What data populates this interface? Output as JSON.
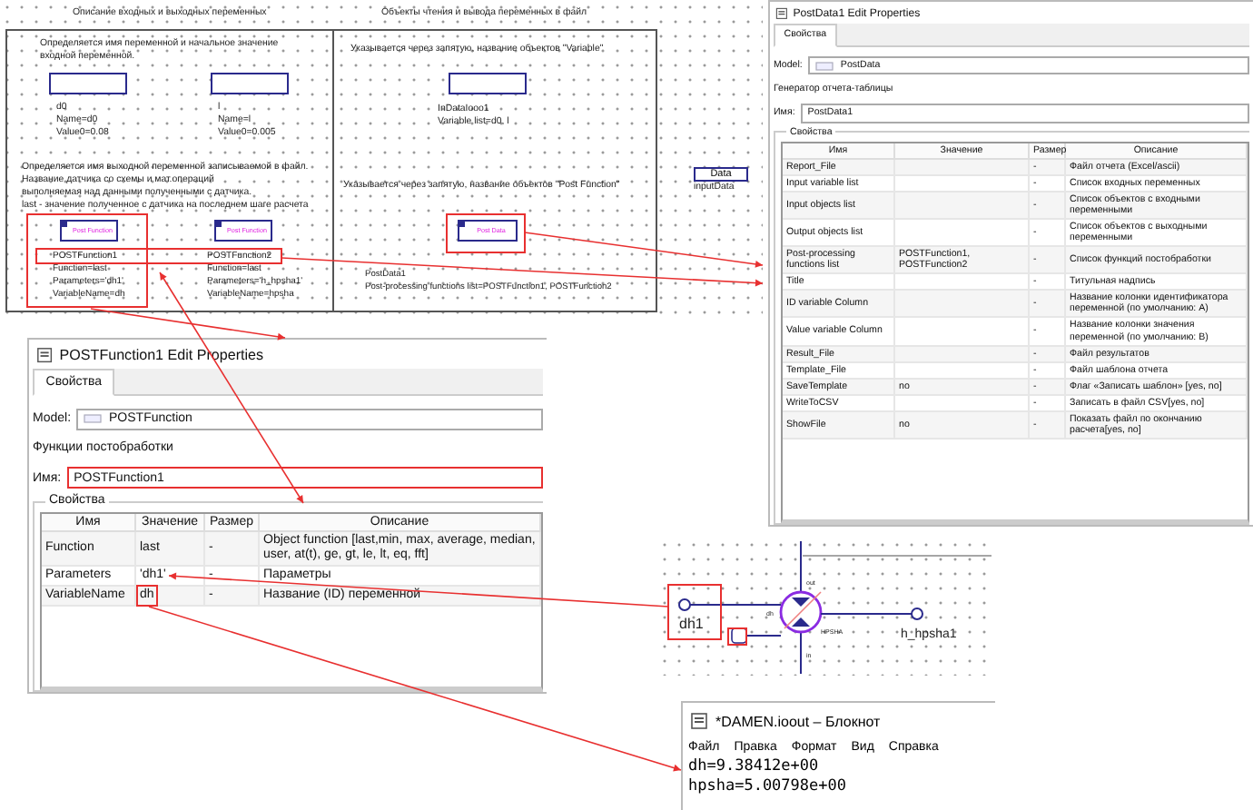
{
  "diagram": {
    "headers": [
      "Описание входных и выходных переменных",
      "Объекты чтения и вывода переменных в файл"
    ],
    "input_note": "Определяется имя переменной и начальное значение входной переменной.",
    "variables": [
      {
        "lines": [
          "d0",
          "Name=d0",
          "Value0=0.08"
        ]
      },
      {
        "lines": [
          "l",
          "Name=l",
          "Value0=0.005"
        ]
      }
    ],
    "output_note_lines": [
      "Определяется имя выходной переменной записываемой в файл.",
      "Название датчика со схемы и мат.операций",
      "выполняемая над данными полученными с датчика.",
      "last - значение полученное с датчика на последнем шаге расчета"
    ],
    "post_functions": [
      {
        "block": "Post Function",
        "lines": [
          "POSTFunction1",
          "Function=last",
          "Parameters='dh1'",
          "VariableName=dh"
        ]
      },
      {
        "block": "Post Function",
        "lines": [
          "POSTFunction2",
          "Function=last",
          "Parameters='h_hpsha1'",
          "VariableName=hpsha"
        ]
      }
    ],
    "variable_note": "Указывается через запятую, название объектов \"Variable\"",
    "input_object": {
      "lines": [
        "InDataIooo1",
        "Variable list=d0, l"
      ]
    },
    "function_note": "Указывается через запятую, название объектов \"Post Function\"",
    "post_data": {
      "block": "Post Data",
      "lines": [
        "PostData1",
        "Post-processing functions list=POSTFunction1, POSTFunction2"
      ]
    },
    "data_block": {
      "block": "Data",
      "caption": "inputData"
    }
  },
  "postdata_window": {
    "title": "PostData1 Edit Properties",
    "tabs": [
      {
        "label": "Свойства",
        "selected": true
      }
    ],
    "model_label": "Model:",
    "model_value": "PostData",
    "description": "Генератор отчета-таблицы",
    "name_label": "Имя:",
    "name_value": "PostData1",
    "group_label": "Свойства",
    "columns": [
      "Имя",
      "Значение",
      "Размер",
      "Описание"
    ],
    "rows": [
      {
        "name": "Report_File",
        "size": "-",
        "description": "Файл отчета (Excel/ascii)"
      },
      {
        "name": "Input variable list",
        "size": "-",
        "description": "Список входных переменных"
      },
      {
        "name": "Input objects list",
        "size": "-",
        "description": "Список объектов с входными переменными"
      },
      {
        "name": "Output objects list",
        "size": "-",
        "description": "Список объектов с выходными переменными"
      },
      {
        "name": "Post-processing functions list",
        "value": "POSTFunction1, POSTFunction2",
        "size": "-",
        "description": "Список функций постобработки"
      },
      {
        "name": "Title",
        "size": "-",
        "description": "Титульная надпись"
      },
      {
        "name": "ID variable Column",
        "size": "-",
        "description": "Название колонки идентификатора переменной (по умолчанию: A)"
      },
      {
        "name": "Value variable Column",
        "size": "-",
        "description": "Название колонки значения переменной (по умолчанию: B)"
      },
      {
        "name": "Result_File",
        "size": "-",
        "description": "Файл результатов"
      },
      {
        "name": "Template_File",
        "size": "-",
        "description": "Файл шаблона отчета"
      },
      {
        "name": "SaveTemplate",
        "value": "no",
        "size": "-",
        "description": "Флаг «Записать шаблон» [yes, no]"
      },
      {
        "name": "WriteToCSV",
        "size": "-",
        "description": "Записать в файл CSV[yes, no]"
      },
      {
        "name": "ShowFile",
        "value": "no",
        "size": "-",
        "description": "Показать файл по окончанию расчета[yes, no]"
      }
    ]
  },
  "postfunction_window": {
    "title": "POSTFunction1 Edit Properties",
    "tabs": [
      {
        "label": "Свойства",
        "selected": true
      }
    ],
    "model_label": "Model:",
    "model_value": "POSTFunction",
    "description": "Функции постобработки",
    "name_label": "Имя:",
    "name_value": "POSTFunction1",
    "group_label": "Свойства",
    "columns": [
      "Имя",
      "Значение",
      "Размер",
      "Описание"
    ],
    "rows": [
      {
        "name": "Function",
        "value": "last",
        "size": "-",
        "description": "Object function [last,min, max, average, median, user, at(t), ge, gt, le, lt, eq, fft]"
      },
      {
        "name": "Parameters",
        "value": "'dh1'",
        "size": "-",
        "description": "Параметры"
      },
      {
        "name": "VariableName",
        "value": "dh",
        "size": "-",
        "description": "Название (ID) переменной"
      }
    ]
  },
  "schematic": {
    "port_labels": [
      "out",
      "dh",
      "HPSHA",
      "in"
    ],
    "input_label": "dh1",
    "output_label": "h_hpsha1"
  },
  "notepad": {
    "title": "*DAMEN.ioout – Блокнот",
    "menu": [
      "Файл",
      "Правка",
      "Формат",
      "Вид",
      "Справка"
    ],
    "lines": [
      "dh=9.38412e+00",
      "hpsha=5.00798e+00"
    ]
  }
}
